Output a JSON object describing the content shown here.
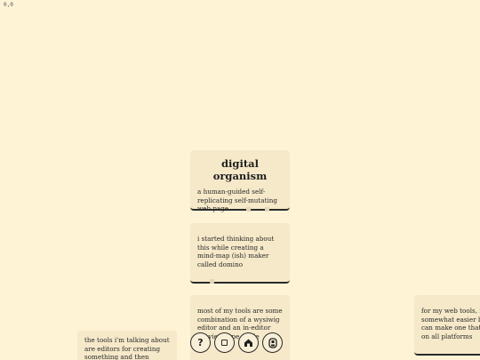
{
  "coordinates": "0,0",
  "cards": {
    "main": {
      "title": "digital organism",
      "body": "a human-guided self-replicating self-mutating web page"
    },
    "mindmap": {
      "body": "i started thinking about this while creating a mind-map (ish) maker called domino"
    },
    "tools": {
      "body": "most of my tools are some combination of a wysiwig editor and an in-editor preview-type mode"
    },
    "editors": {
      "body": "the tools i'm talking about are editors for creating something and then saving"
    },
    "webtools": {
      "body": "for my web tools, it's somewhat easier bc you can make one that works on all platforms"
    }
  },
  "toolbar": {
    "help_label": "?",
    "add_icon": "square-icon",
    "home_icon": "home-icon",
    "save_icon": "save-icon"
  }
}
